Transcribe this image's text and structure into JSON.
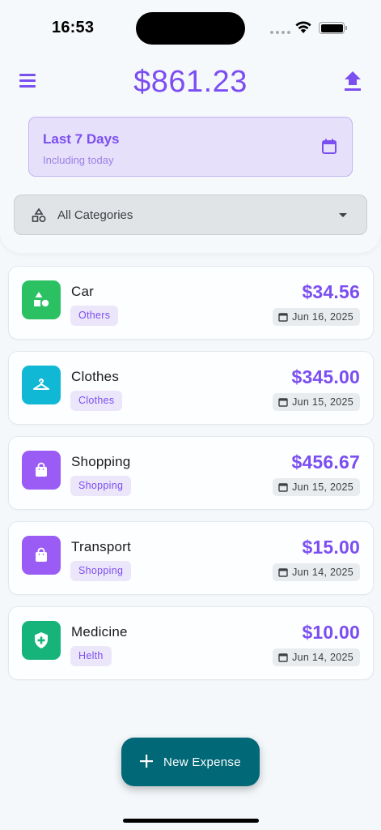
{
  "status": {
    "time": "16:53"
  },
  "header": {
    "total": "$861.23",
    "date_range_title": "Last 7 Days",
    "date_range_subtitle": "Including today",
    "category_filter": "All Categories"
  },
  "expenses": [
    {
      "name": "Car",
      "category": "Others",
      "amount": "$34.56",
      "date": "Jun 16, 2025",
      "color": "#2bc163",
      "icon": "shapes-icon"
    },
    {
      "name": "Clothes",
      "category": "Clothes",
      "amount": "$345.00",
      "date": "Jun 15, 2025",
      "color": "#11b8d6",
      "icon": "hanger-icon"
    },
    {
      "name": "Shopping",
      "category": "Shopping",
      "amount": "$456.67",
      "date": "Jun 15, 2025",
      "color": "#9b5cf6",
      "icon": "shopping-bag-icon"
    },
    {
      "name": "Transport",
      "category": "Shopping",
      "amount": "$15.00",
      "date": "Jun 14, 2025",
      "color": "#9b5cf6",
      "icon": "shopping-bag-icon"
    },
    {
      "name": "Medicine",
      "category": "Helth",
      "amount": "$10.00",
      "date": "Jun 14, 2025",
      "color": "#16b47b",
      "icon": "medical-shield-icon"
    }
  ],
  "fab": {
    "label": "New Expense"
  },
  "colors": {
    "accent": "#7b4ef2",
    "fab": "#006876"
  }
}
